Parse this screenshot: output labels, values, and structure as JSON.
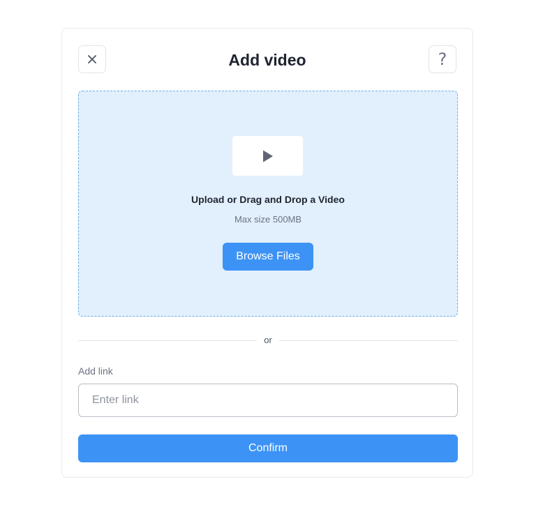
{
  "dialog": {
    "title": "Add video",
    "close_icon": "close-icon",
    "help_icon": "help-icon",
    "help_glyph": "?"
  },
  "dropzone": {
    "icon": "play-icon",
    "heading": "Upload or Drag and Drop a Video",
    "subtext": "Max size 500MB",
    "browse_label": "Browse Files"
  },
  "divider": {
    "label": "or"
  },
  "link": {
    "label": "Add link",
    "placeholder": "Enter link",
    "value": ""
  },
  "confirm_label": "Confirm",
  "colors": {
    "accent": "#3d93f5",
    "dropzone_bg": "#e2f0fd",
    "dropzone_border": "#6aaee0"
  }
}
